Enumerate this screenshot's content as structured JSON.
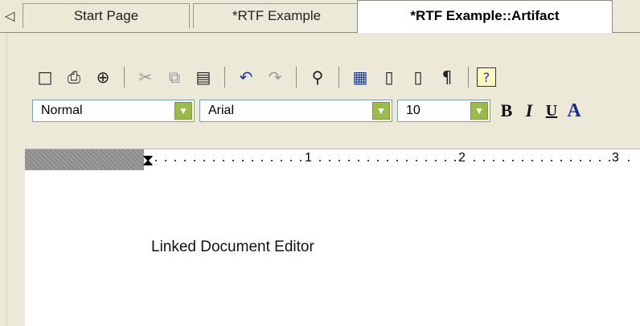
{
  "tabs": [
    {
      "label": "Start Page",
      "active": false
    },
    {
      "label": "*RTF Example",
      "active": false
    },
    {
      "label": "*RTF Example::Artifact",
      "active": true
    }
  ],
  "tab_scroll_icon": "triangle-left-icon",
  "toolbar1": [
    {
      "icon": "new-document-icon",
      "glyph": "🗋"
    },
    {
      "icon": "print-icon",
      "glyph": "🖶"
    },
    {
      "icon": "print-preview-icon",
      "glyph": "🔍"
    },
    {
      "icon": "cut-icon",
      "glyph": "✂"
    },
    {
      "icon": "copy-icon",
      "glyph": "⧉"
    },
    {
      "icon": "paste-icon",
      "glyph": "📋"
    },
    {
      "icon": "undo-icon",
      "glyph": "↶"
    },
    {
      "icon": "redo-icon",
      "glyph": "↷"
    },
    {
      "icon": "find-icon",
      "glyph": "⌕"
    },
    {
      "icon": "calendar-icon",
      "glyph": "📅"
    },
    {
      "icon": "page-icon",
      "glyph": "🗏"
    },
    {
      "icon": "page-number-icon",
      "glyph": "🗐"
    },
    {
      "icon": "paragraph-icon",
      "glyph": "¶"
    },
    {
      "icon": "help-icon",
      "glyph": "?"
    }
  ],
  "format": {
    "style_value": "Normal",
    "font_value": "Arial",
    "size_value": "10",
    "bold_label": "B",
    "italic_label": "I",
    "underline_label": "U",
    "color_label": "A"
  },
  "ruler": {
    "marks": [
      "1",
      "2",
      "3"
    ]
  },
  "document": {
    "text": "Linked Document Editor"
  },
  "colors": {
    "combo_arrow": "#9dbb4c",
    "background": "#ece9d8"
  }
}
